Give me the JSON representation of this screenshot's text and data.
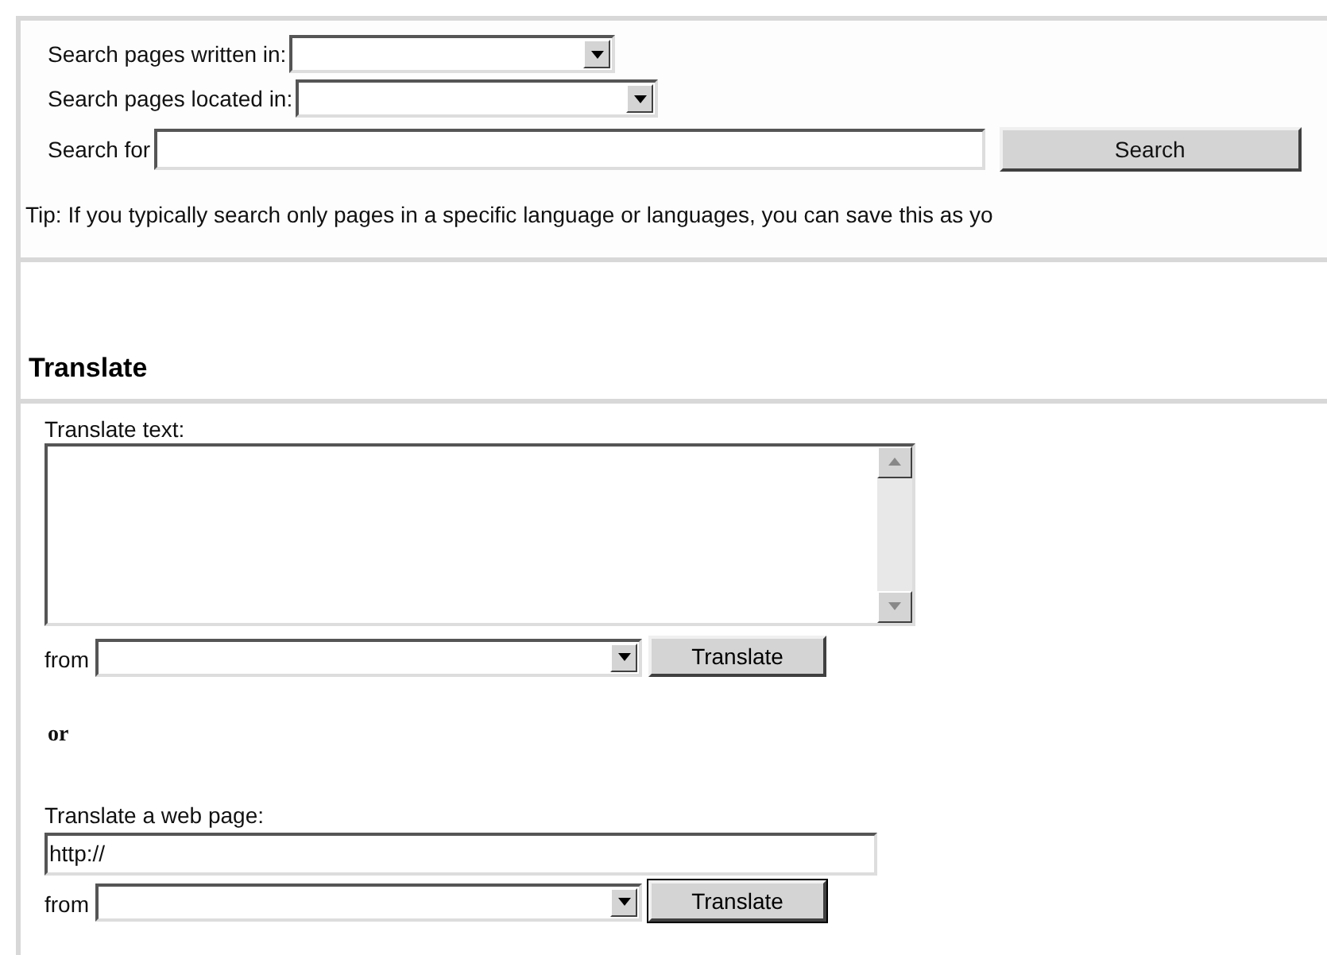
{
  "search": {
    "language_label": "Search pages written in:",
    "location_label": "Search pages located in:",
    "query_label": "Search for",
    "button": "Search",
    "tip": "Tip: If you typically search only pages in a specific language or languages, you can save this as yo"
  },
  "translate": {
    "heading": "Translate",
    "text_label": "Translate text:",
    "from_label_1": "from",
    "button_1": "Translate",
    "or": "or",
    "page_label": "Translate a web page:",
    "url_value": "http://",
    "from_label_2": "from",
    "button_2": "Translate"
  }
}
